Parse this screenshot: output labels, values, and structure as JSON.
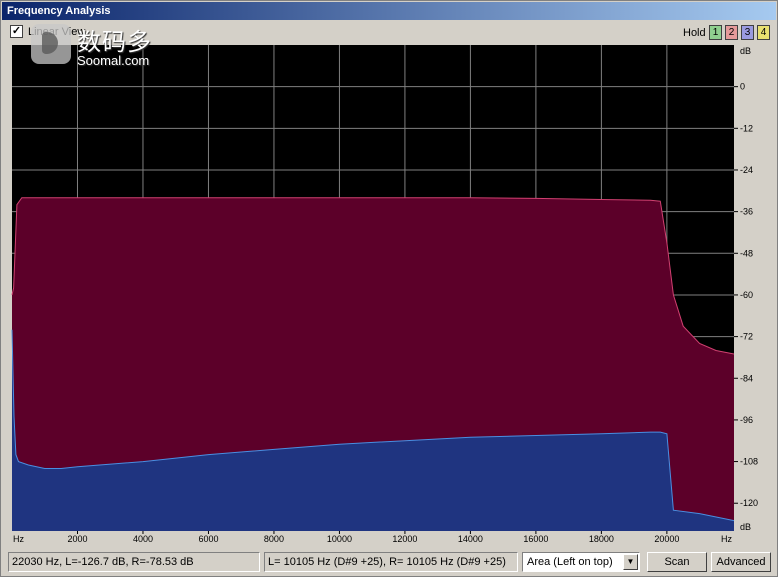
{
  "window": {
    "title": "Frequency Analysis"
  },
  "toolbar": {
    "linear_view_label": "Linear View",
    "linear_view_checked": true,
    "hold_label": "Hold",
    "hold_buttons": [
      {
        "label": "1",
        "color": "#8fd08f"
      },
      {
        "label": "2",
        "color": "#e59a9a"
      },
      {
        "label": "3",
        "color": "#9a9ae0"
      },
      {
        "label": "4",
        "color": "#e8e070"
      }
    ]
  },
  "watermark": {
    "cn": "数码多",
    "en": "Soomal.com"
  },
  "chart_data": {
    "type": "area",
    "x_axis": {
      "min": 0,
      "max": 22050,
      "ticks": [
        2000,
        4000,
        6000,
        8000,
        10000,
        12000,
        14000,
        16000,
        18000,
        20000
      ],
      "tick_labels": [
        "2000",
        "4000",
        "6000",
        "8000",
        "10000",
        "12000",
        "14000",
        "16000",
        "18000",
        "20000"
      ],
      "unit_left": "Hz",
      "unit_right": "Hz"
    },
    "y_axis": {
      "min": -128,
      "max": 12,
      "ticks": [
        0,
        -12,
        -24,
        -36,
        -48,
        -60,
        -72,
        -84,
        -96,
        -108,
        -120
      ],
      "tick_labels": [
        "0",
        "-12",
        "-24",
        "-36",
        "-48",
        "-60",
        "-72",
        "-84",
        "-96",
        "-108",
        "-120"
      ],
      "unit_top": "dB",
      "unit_bottom": "dB"
    },
    "grid": true,
    "colors": {
      "background": "#000000",
      "left": "#5c0029",
      "left_edge": "#d04070",
      "right": "#1f3480",
      "right_edge": "#4a8ee0",
      "grid": "#808080"
    },
    "series": [
      {
        "channel": "left",
        "x": [
          0,
          50,
          150,
          300,
          500,
          2000,
          6000,
          10000,
          14000,
          16000,
          18000,
          19500,
          19800,
          20000,
          20200,
          20500,
          21000,
          21500,
          22050
        ],
        "y": [
          -60,
          -58,
          -34,
          -32,
          -32,
          -32,
          -32,
          -32,
          -32,
          -32.2,
          -32.5,
          -32.7,
          -33,
          -45,
          -60,
          -69,
          -74,
          -76,
          -77
        ]
      },
      {
        "channel": "right",
        "x": [
          0,
          60,
          120,
          200,
          500,
          1000,
          1500,
          2000,
          4000,
          6000,
          8000,
          10000,
          12000,
          14000,
          16000,
          18000,
          19500,
          19800,
          20000,
          20200,
          21000,
          22050
        ],
        "y": [
          -70,
          -95,
          -106,
          -108,
          -109,
          -110,
          -110,
          -109.5,
          -108,
          -106,
          -104.5,
          -103,
          -102,
          -101,
          -100.5,
          -100,
          -99.5,
          -99.5,
          -100,
          -122,
          -123,
          -125
        ]
      }
    ]
  },
  "status": {
    "cursor_readout": "22030 Hz, L=-126.7 dB, R=-78.53 dB",
    "peak_readout": "L=  10105 Hz (D#9 +25), R=  10105 Hz (D#9 +25)",
    "display_mode": "Area (Left on top)",
    "scan_label": "Scan",
    "advanced_label": "Advanced"
  }
}
